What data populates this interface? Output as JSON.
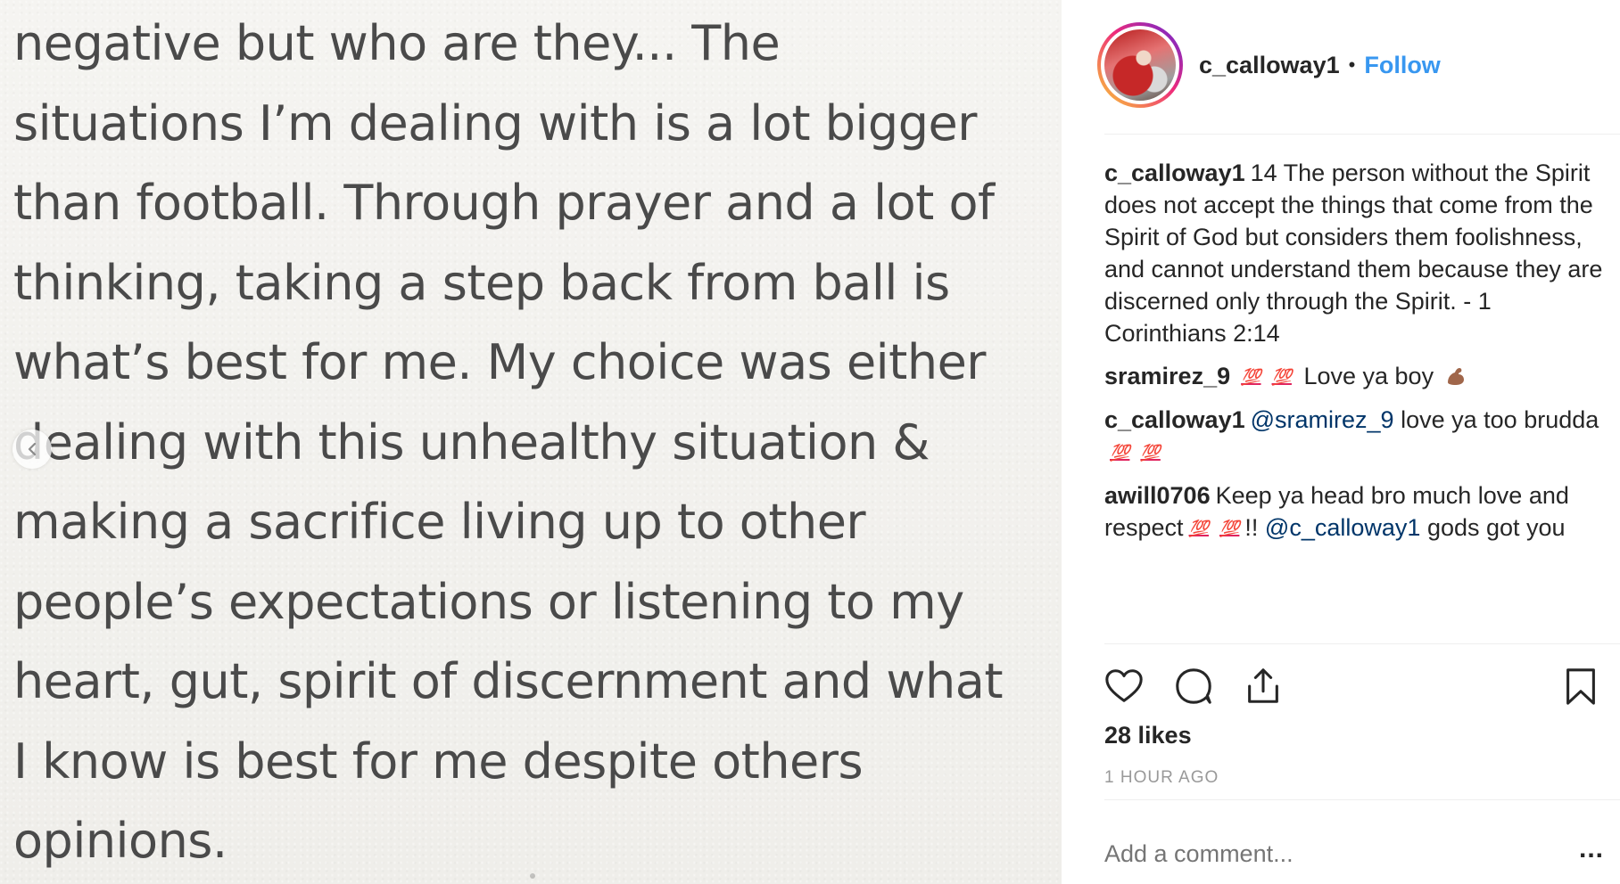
{
  "image": {
    "lines": [
      "negative but who are they...  The",
      "situations I’m dealing with is a lot bigger",
      "than football. Through prayer and a lot of",
      "thinking, taking a step back from ball is",
      "what’s best for me. My choice was either",
      "dealing with this unhealthy situation &",
      "making a sacrifice living up to other",
      "people’s expectations or listening to my",
      "heart, gut, spirit of discernment and what",
      "I know is best for me despite others",
      "opinions."
    ],
    "prev_icon": "chevron-left-icon"
  },
  "header": {
    "username": "c_calloway1",
    "separator": "•",
    "follow_label": "Follow"
  },
  "comments": [
    {
      "user": "c_calloway1",
      "text": "14 The person without the Spirit does not accept the things that come from the Spirit of God but considers them foolishness, and cannot understand them because they are discerned only through the Spirit. - 1 Corinthians 2:14"
    },
    {
      "user": "sramirez_9",
      "emoji": "💯",
      "text": "Love ya boy",
      "emoji_icon": "flexed-biceps-icon"
    },
    {
      "user": "c_calloway1",
      "mention": "@sramirez_9",
      "text_a": "love ya too",
      "text_b": "brudda",
      "emoji": "💯"
    },
    {
      "user": "awill0706",
      "text_a": "Keep ya head bro much love and respect",
      "emoji": "💯",
      "text_b": "!!",
      "mention": "@c_calloway1",
      "text_c": "gods got you"
    }
  ],
  "actions": {
    "like_icon": "heart-icon",
    "comment_icon": "comment-icon",
    "share_icon": "share-icon",
    "save_icon": "bookmark-icon"
  },
  "likes": "28 likes",
  "time": "1 HOUR AGO",
  "add_comment": {
    "placeholder": "Add a comment..."
  },
  "more_label": "...",
  "colors": {
    "link": "#3897f0",
    "mention": "#003569",
    "hundred": "#e0245e",
    "meta": "#999999"
  }
}
